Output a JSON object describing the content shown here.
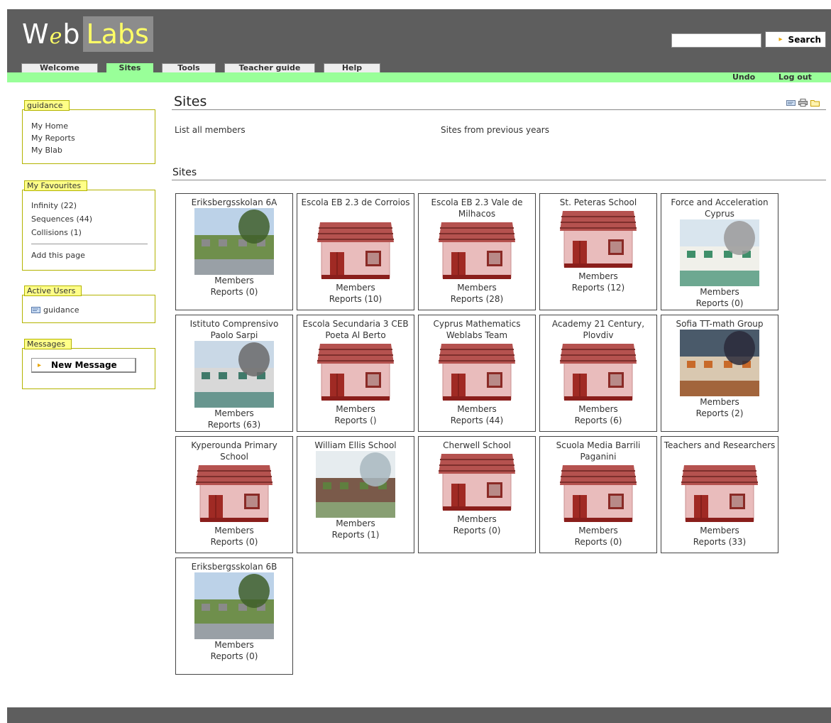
{
  "header": {
    "logo_web": "We",
    "logo_e": "b",
    "logo_labs": "Labs",
    "search_value": "",
    "search_label": "Search",
    "tabs": [
      {
        "label": "Welcome"
      },
      {
        "label": "Sites"
      },
      {
        "label": "Tools"
      },
      {
        "label": "Teacher guide"
      },
      {
        "label": "Help"
      }
    ],
    "undo": "Undo",
    "logout": "Log out"
  },
  "sidebar": {
    "guidance": {
      "title": "guidance",
      "items": [
        "My Home",
        "My Reports",
        "My Blab"
      ]
    },
    "favourites": {
      "title": "My Favourites",
      "items": [
        "Infinity (22)",
        "Sequences (44)",
        "Collisions (1)"
      ],
      "add": "Add this page"
    },
    "active_users": {
      "title": "Active Users",
      "user": "guidance"
    },
    "messages": {
      "title": "Messages",
      "new_message": "New Message"
    }
  },
  "main": {
    "title": "Sites",
    "list_all": "List all members",
    "previous_years": "Sites from previous years",
    "section_title": "Sites",
    "members_label": "Members",
    "sites": [
      {
        "name": "Eriksbergsskolan 6A",
        "reports": "Reports (0)",
        "image": "school-photo"
      },
      {
        "name": "Escola EB 2.3 de Corroios",
        "reports": "Reports (10)",
        "image": "house-icon"
      },
      {
        "name": "Escola EB 2.3 Vale de Milhacos",
        "reports": "Reports (28)",
        "image": "house-icon"
      },
      {
        "name": "St. Peteras School",
        "reports": "Reports (12)",
        "image": "house-icon"
      },
      {
        "name": "Force and Acceleration Cyprus",
        "reports": "Reports (0)",
        "image": "building-photo"
      },
      {
        "name": "Istituto Comprensivo Paolo Sarpi",
        "reports": "Reports (63)",
        "image": "entrance-photo"
      },
      {
        "name": "Escola Secundaria 3 CEB Poeta Al Berto",
        "reports": "Reports ()",
        "image": "house-icon"
      },
      {
        "name": "Cyprus Mathematics Weblabs Team",
        "reports": "Reports (44)",
        "image": "house-icon"
      },
      {
        "name": "Academy 21 Century, Plovdiv",
        "reports": "Reports (6)",
        "image": "house-icon"
      },
      {
        "name": "Sofia TT-math Group",
        "reports": "Reports (2)",
        "image": "group-photo"
      },
      {
        "name": "Kyperounda Primary School",
        "reports": "Reports (0)",
        "image": "house-icon"
      },
      {
        "name": "William Ellis School",
        "reports": "Reports (1)",
        "image": "brick-school-photo"
      },
      {
        "name": "Cherwell School",
        "reports": "Reports (0)",
        "image": "house-icon"
      },
      {
        "name": "Scuola Media Barrili Paganini",
        "reports": "Reports (0)",
        "image": "house-icon"
      },
      {
        "name": "Teachers and Researchers",
        "reports": "Reports (33)",
        "image": "house-icon"
      },
      {
        "name": "Eriksbergsskolan 6B",
        "reports": "Reports (0)",
        "image": "school-photo"
      }
    ]
  },
  "colors": {
    "header_bg": "#5e5e5e",
    "accent_green": "#99ff99",
    "sidebar_title_bg": "#ffff88",
    "logo_yellow": "#ffff66"
  }
}
